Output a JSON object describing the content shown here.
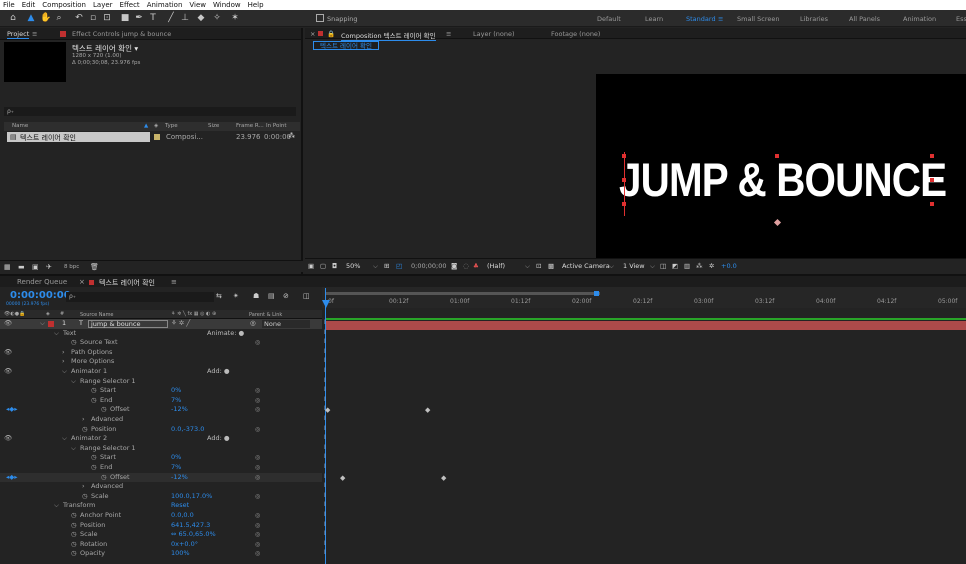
{
  "menu": [
    "File",
    "Edit",
    "Composition",
    "Layer",
    "Effect",
    "Animation",
    "View",
    "Window",
    "Help"
  ],
  "toolbar": {
    "snapping_label": "Snapping",
    "workspaces": [
      "Default",
      "Learn",
      "Standard",
      "Small Screen",
      "Libraries",
      "All Panels",
      "Animation",
      "Ess"
    ]
  },
  "project": {
    "tab_label": "Project",
    "effect_controls_label": "Effect Controls jump & bounce",
    "comp_name": "텍스트 레이어 확인 ▾",
    "comp_size": "1280 x 720 (1.00)",
    "comp_duration": "Δ 0;00;30;08, 23.976 fps",
    "search_placeholder": "ρ₊",
    "columns": [
      "Name",
      "Type",
      "Size",
      "Frame R...",
      "In Point"
    ],
    "item": {
      "name": "텍스트 레이어 확인",
      "type": "Composi...",
      "fps": "23.976",
      "in_point": "0:00:00"
    },
    "footer": "8 bpc"
  },
  "composition": {
    "tab_label": "Composition 텍스트 레이어 확인",
    "layer_tab": "Layer (none)",
    "footage_tab": "Footage (none)",
    "crumb": "텍스트 레이어 확인",
    "canvas_text": "JUMP & BOUNCE",
    "footer": {
      "zoom": "50%",
      "timecode": "0;00;00;00",
      "resolution": "(Half)",
      "camera": "Active Camera",
      "view": "1 View",
      "exposure": "+0.0"
    }
  },
  "timeline": {
    "render_queue": "Render Queue",
    "comp_tab": "텍스트 레이어 확인",
    "timecode": "0:00:00:00",
    "timecode_sub": "00000 (23.976 fps)",
    "search_placeholder": "ρ₊",
    "ruler": [
      "0f",
      "00:12f",
      "01:00f",
      "01:12f",
      "02:00f",
      "02:12f",
      "03:00f",
      "03:12f",
      "04:00f",
      "04:12f",
      "05:00f"
    ],
    "layer_header": {
      "source_name": "Source Name",
      "parent": "Parent & Link"
    },
    "layer": {
      "num": "1",
      "name": "jump & bounce",
      "parent": "None"
    },
    "properties": [
      {
        "indent": 63,
        "name": "Text",
        "value": "",
        "extra": "Animate: ●",
        "sp": false
      },
      {
        "indent": 80,
        "name": "Source Text",
        "value": "",
        "extra": "",
        "sp": true
      },
      {
        "indent": 71,
        "name": "Path Options",
        "value": "",
        "extra": "",
        "sp": false
      },
      {
        "indent": 71,
        "name": "More Options",
        "value": "",
        "extra": "",
        "sp": false
      },
      {
        "indent": 71,
        "name": "Animator 1",
        "value": "",
        "extra": "Add: ●",
        "sp": false
      },
      {
        "indent": 80,
        "name": "Range Selector 1",
        "value": "",
        "extra": "",
        "sp": false
      },
      {
        "indent": 100,
        "name": "Start",
        "value": "0%",
        "extra": "",
        "sp": true
      },
      {
        "indent": 100,
        "name": "End",
        "value": "7%",
        "extra": "",
        "sp": true
      },
      {
        "indent": 110,
        "name": "Offset",
        "value": "-12%",
        "extra": "",
        "sp": true
      },
      {
        "indent": 91,
        "name": "Advanced",
        "value": "",
        "extra": "",
        "sp": false
      },
      {
        "indent": 91,
        "name": "Position",
        "value": "0.0,-373.0",
        "extra": "",
        "sp": true
      },
      {
        "indent": 71,
        "name": "Animator 2",
        "value": "",
        "extra": "Add: ●",
        "sp": false
      },
      {
        "indent": 80,
        "name": "Range Selector 1",
        "value": "",
        "extra": "",
        "sp": false
      },
      {
        "indent": 100,
        "name": "Start",
        "value": "0%",
        "extra": "",
        "sp": true
      },
      {
        "indent": 100,
        "name": "End",
        "value": "7%",
        "extra": "",
        "sp": true
      },
      {
        "indent": 110,
        "name": "Offset",
        "value": "-12%",
        "extra": "",
        "sp": true
      },
      {
        "indent": 91,
        "name": "Advanced",
        "value": "",
        "extra": "",
        "sp": false
      },
      {
        "indent": 91,
        "name": "Scale",
        "value": "100.0,17.0%",
        "extra": "",
        "sp": true
      },
      {
        "indent": 63,
        "name": "Transform",
        "value": "Reset",
        "extra": "",
        "sp": false
      },
      {
        "indent": 80,
        "name": "Anchor Point",
        "value": "0.0,0.0",
        "extra": "",
        "sp": true
      },
      {
        "indent": 80,
        "name": "Position",
        "value": "641.5,427.3",
        "extra": "",
        "sp": true
      },
      {
        "indent": 80,
        "name": "Scale",
        "value": "⇔ 65.0,65.0%",
        "extra": "",
        "sp": true
      },
      {
        "indent": 80,
        "name": "Rotation",
        "value": "0x+0.0°",
        "extra": "",
        "sp": true
      },
      {
        "indent": 80,
        "name": "Opacity",
        "value": "100%",
        "extra": "",
        "sp": true
      }
    ]
  }
}
